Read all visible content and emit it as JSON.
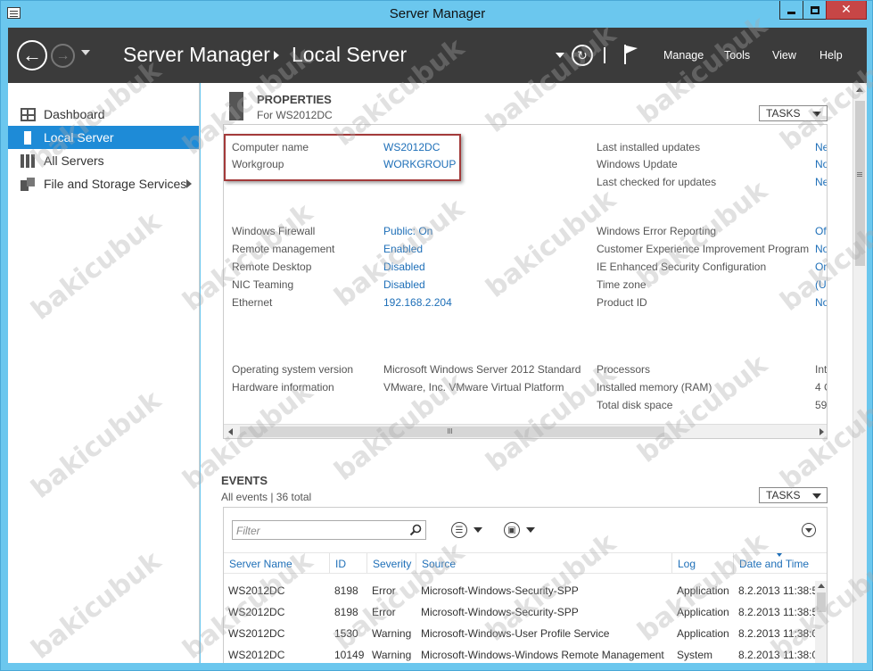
{
  "window": {
    "title": "Server Manager"
  },
  "header": {
    "breadcrumb": [
      "Server Manager",
      "Local Server"
    ],
    "menus": [
      "Manage",
      "Tools",
      "View",
      "Help"
    ]
  },
  "sidebar": {
    "items": [
      {
        "label": "Dashboard",
        "icon": "dashboard-icon",
        "active": false
      },
      {
        "label": "Local Server",
        "icon": "server-icon",
        "active": true
      },
      {
        "label": "All Servers",
        "icon": "servers-icon",
        "active": false
      },
      {
        "label": "File and Storage Services",
        "icon": "storage-icon",
        "active": false
      }
    ]
  },
  "properties": {
    "title": "PROPERTIES",
    "subtitle": "For WS2012DC",
    "tasks_label": "TASKS",
    "left": [
      {
        "label": "Computer name",
        "value": "WS2012DC"
      },
      {
        "label": "Workgroup",
        "value": "WORKGROUP"
      },
      {
        "label": "Windows Firewall",
        "value": "Public: On"
      },
      {
        "label": "Remote management",
        "value": "Enabled"
      },
      {
        "label": "Remote Desktop",
        "value": "Disabled"
      },
      {
        "label": "NIC Teaming",
        "value": "Disabled"
      },
      {
        "label": "Ethernet",
        "value": "192.168.2.204"
      },
      {
        "label": "Operating system version",
        "value": "Microsoft Windows Server 2012 Standard"
      },
      {
        "label": "Hardware information",
        "value": "VMware, Inc. VMware Virtual Platform"
      }
    ],
    "right": [
      {
        "label": "Last installed updates",
        "value": "Ne"
      },
      {
        "label": "Windows Update",
        "value": "No"
      },
      {
        "label": "Last checked for updates",
        "value": "Ne"
      },
      {
        "label": "Windows Error Reporting",
        "value": "Of"
      },
      {
        "label": "Customer Experience Improvement Program",
        "value": "No"
      },
      {
        "label": "IE Enhanced Security Configuration",
        "value": "On"
      },
      {
        "label": "Time zone",
        "value": "(U"
      },
      {
        "label": "Product ID",
        "value": "No"
      },
      {
        "label": "Processors",
        "value": "Int"
      },
      {
        "label": "Installed memory (RAM)",
        "value": "4 G"
      },
      {
        "label": "Total disk space",
        "value": "59"
      }
    ]
  },
  "events": {
    "title": "EVENTS",
    "subtitle": "All events | 36 total",
    "tasks_label": "TASKS",
    "filter_placeholder": "Filter",
    "columns": [
      "Server Name",
      "ID",
      "Severity",
      "Source",
      "Log",
      "Date and Time"
    ],
    "rows": [
      [
        "WS2012DC",
        "8198",
        "Error",
        "Microsoft-Windows-Security-SPP",
        "Application",
        "8.2.2013 11:38:5"
      ],
      [
        "WS2012DC",
        "8198",
        "Error",
        "Microsoft-Windows-Security-SPP",
        "Application",
        "8.2.2013 11:38:5"
      ],
      [
        "WS2012DC",
        "1530",
        "Warning",
        "Microsoft-Windows-User Profile Service",
        "Application",
        "8.2.2013 11:38:0"
      ],
      [
        "WS2012DC",
        "10149",
        "Warning",
        "Microsoft-Windows-Windows Remote Management",
        "System",
        "8.2.2013 11:38:0"
      ]
    ]
  },
  "watermark": "bakicubuk"
}
